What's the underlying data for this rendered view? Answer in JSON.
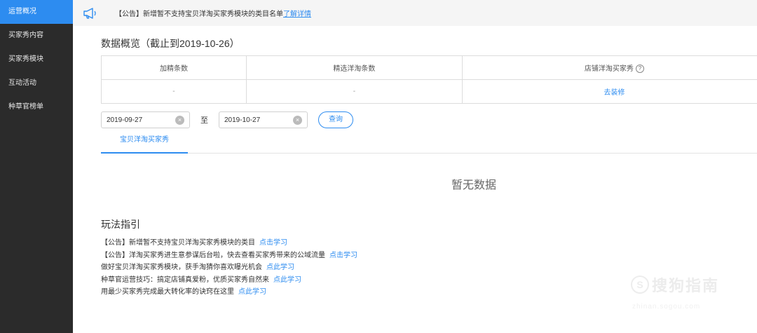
{
  "sidebar": {
    "items": [
      {
        "label": "运营概况",
        "active": true
      },
      {
        "label": "买家秀内容",
        "active": false
      },
      {
        "label": "买家秀模块",
        "active": false
      },
      {
        "label": "互动活动",
        "active": false
      },
      {
        "label": "种草官榜单",
        "active": false
      }
    ]
  },
  "notice": {
    "icon": "megaphone-icon",
    "text": "【公告】新增暂不支持宝贝洋淘买家秀模块的类目名单",
    "link": "了解详情"
  },
  "overview": {
    "title": "数据概览（截止到2019-10-26）",
    "columns": [
      "加精条数",
      "精选洋淘条数",
      "店铺洋淘买家秀"
    ],
    "help_icon": "?",
    "values": [
      "-",
      "-"
    ],
    "action_link": "去装修"
  },
  "filter": {
    "start_date": "2019-09-27",
    "end_date": "2019-10-27",
    "to_label": "至",
    "clear_glyph": "×",
    "query_button": "查询"
  },
  "tabs": [
    {
      "label": "宝贝洋淘买家秀",
      "active": true
    }
  ],
  "empty_state": "暂无数据",
  "guide": {
    "title": "玩法指引",
    "items": [
      {
        "text": "【公告】新增暂不支持宝贝洋淘买家秀模块的类目",
        "link": "点击学习"
      },
      {
        "text": "【公告】洋淘买家秀进生意参谋后台啦，快去查看买家秀带来的公域流量",
        "link": "点击学习"
      },
      {
        "text": "做好宝贝洋淘买家秀模块，获手淘猜你喜欢曝光机会",
        "link": "点此学习"
      },
      {
        "text": "种草官运营技巧：搞定店铺真爱粉，优质买家秀自然来",
        "link": "点此学习"
      },
      {
        "text": "用最少买家秀完成最大转化率的诀窍在这里",
        "link": "点此学习"
      }
    ]
  },
  "watermark": {
    "logo": "S",
    "text": "搜狗指南",
    "url": "zhinan.sogou.com"
  },
  "colors": {
    "accent": "#2d8cf0",
    "sidebar_bg": "#2b2b2b"
  }
}
